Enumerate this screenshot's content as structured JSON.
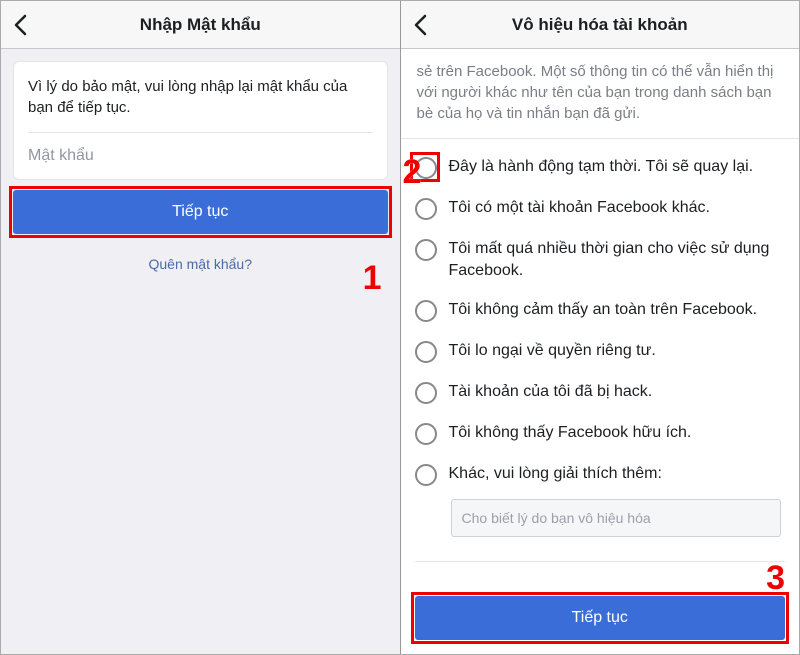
{
  "left": {
    "title": "Nhập Mật khẩu",
    "info": "Vì lý do bảo mật, vui lòng nhập lại mật khẩu của bạn để tiếp tục.",
    "password_placeholder": "Mật khẩu",
    "continue": "Tiếp tục",
    "forgot": "Quên mật khẩu?",
    "step": "1"
  },
  "right": {
    "title": "Vô hiệu hóa tài khoản",
    "intro": "sẻ trên Facebook. Một số thông tin có thể vẫn hiển thị với người khác như tên của bạn trong danh sách bạn bè của họ và tin nhắn bạn đã gửi.",
    "options": [
      "Đây là hành động tạm thời. Tôi sẽ quay lại.",
      "Tôi có một tài khoản Facebook khác.",
      "Tôi mất quá nhiều thời gian cho việc sử dụng Facebook.",
      "Tôi không cảm thấy an toàn trên Facebook.",
      "Tôi lo ngại về quyền riêng tư.",
      "Tài khoản của tôi đã bị hack.",
      "Tôi không thấy Facebook hữu ích.",
      "Khác, vui lòng giải thích thêm:"
    ],
    "reason_placeholder": "Cho biết lý do bạn vô hiệu hóa",
    "continue": "Tiếp tục",
    "step_radio": "2",
    "step_btn": "3"
  }
}
